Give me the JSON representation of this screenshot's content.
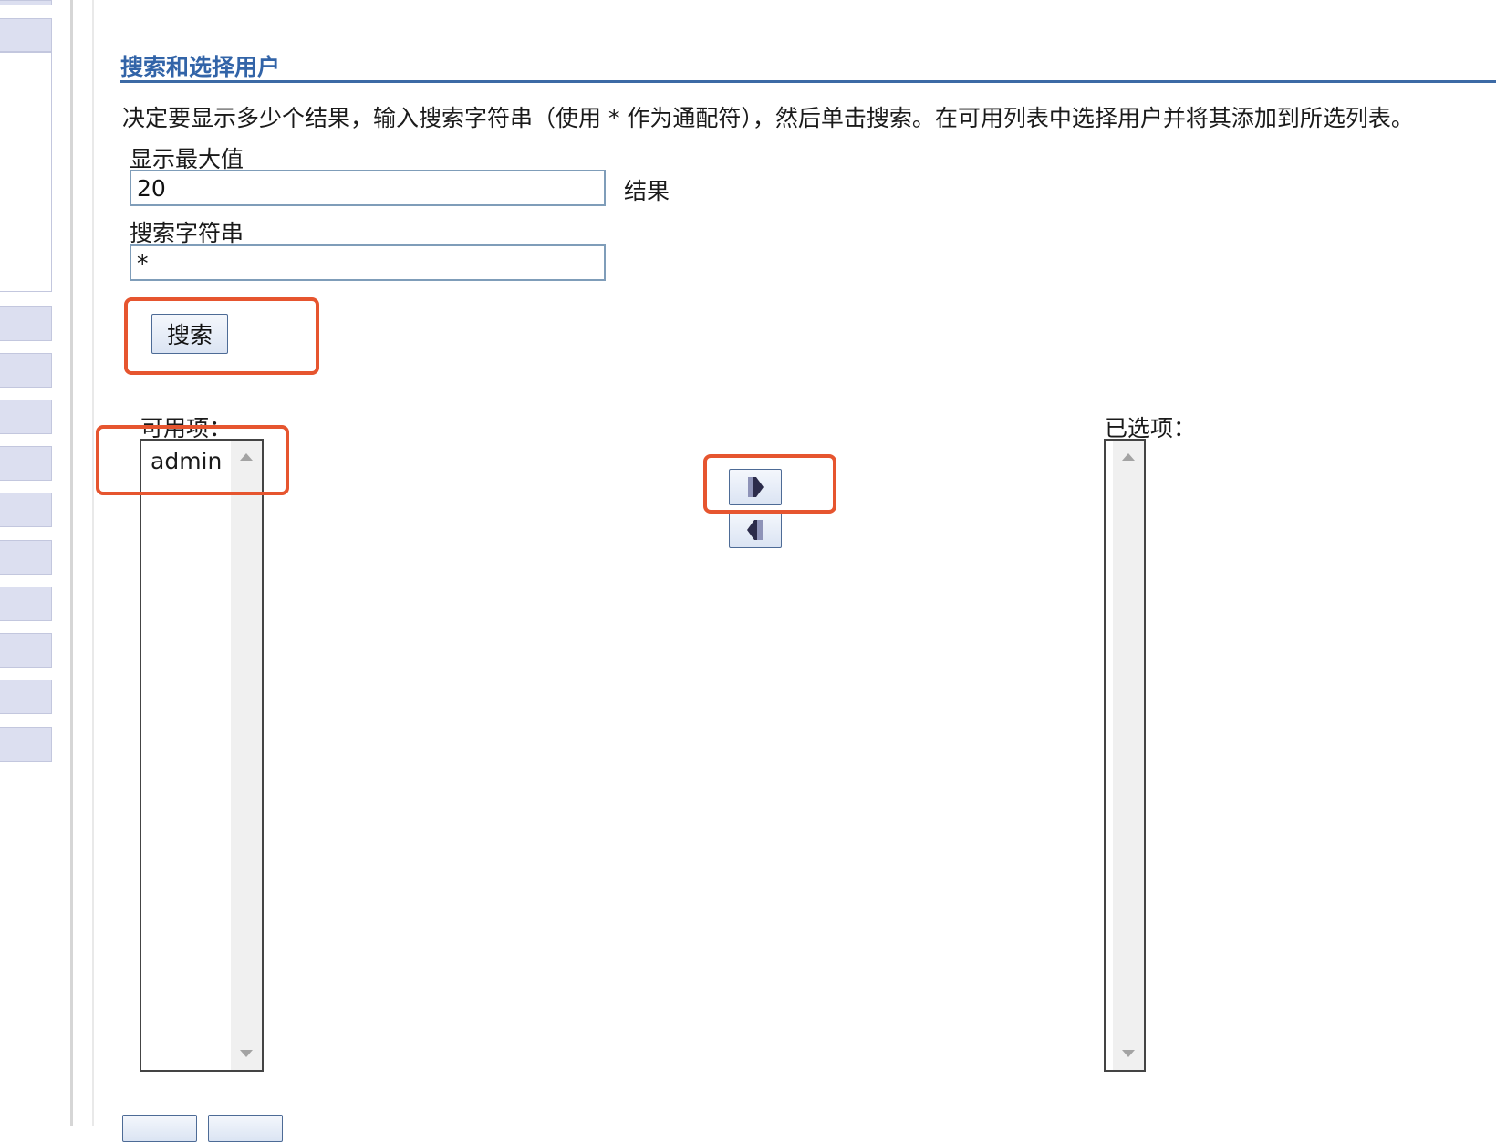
{
  "section": {
    "title": "搜索和选择用户",
    "instructions": "决定要显示多少个结果，输入搜索字符串（使用 * 作为通配符），然后单击搜索。在可用列表中选择用户并将其添加到所选列表。"
  },
  "form": {
    "max_label": "显示最大值",
    "max_value": "20",
    "max_unit": "结果",
    "search_label": "搜索字符串",
    "search_value": "*",
    "search_button": "搜索"
  },
  "lists": {
    "available_label": "可用项：",
    "available_items": [
      "admin"
    ],
    "selected_label": "已选项：",
    "selected_items": []
  },
  "icons": {
    "add": "arrow-right-icon",
    "remove": "arrow-left-icon"
  },
  "colors": {
    "title": "#3264a8",
    "highlight": "#e6552f",
    "nav_block": "#dcdff0"
  }
}
